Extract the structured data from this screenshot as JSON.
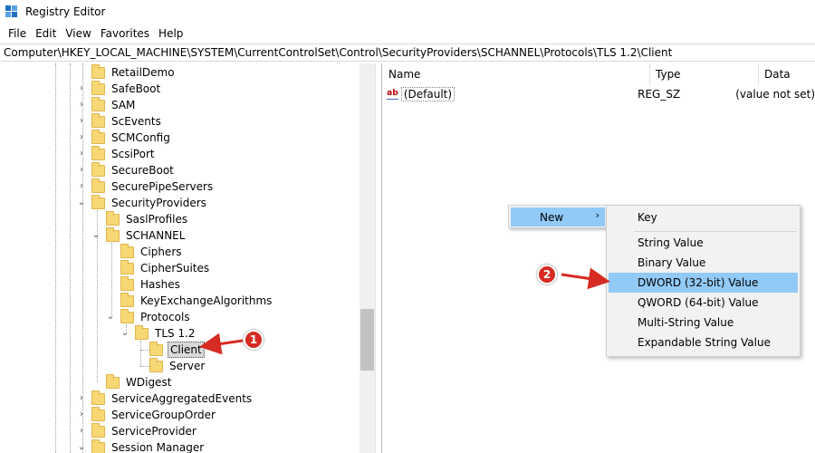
{
  "window": {
    "title": "Registry Editor"
  },
  "menu": [
    "File",
    "Edit",
    "View",
    "Favorites",
    "Help"
  ],
  "address": "Computer\\HKEY_LOCAL_MACHINE\\SYSTEM\\CurrentControlSet\\Control\\SecurityProviders\\SCHANNEL\\Protocols\\TLS 1.2\\Client",
  "tree": {
    "items": [
      {
        "label": "RetailDemo",
        "expanded": false
      },
      {
        "label": "SafeBoot",
        "expanded": false
      },
      {
        "label": "SAM",
        "expanded": false
      },
      {
        "label": "ScEvents",
        "expanded": false
      },
      {
        "label": "SCMConfig",
        "expanded": false
      },
      {
        "label": "ScsiPort",
        "expanded": false
      },
      {
        "label": "SecureBoot",
        "expanded": false
      },
      {
        "label": "SecurePipeServers",
        "expanded": false
      },
      {
        "label": "SecurityProviders",
        "expanded": true
      },
      {
        "label": "SaslProfiles",
        "expanded": false
      },
      {
        "label": "SCHANNEL",
        "expanded": true
      },
      {
        "label": "Ciphers",
        "expanded": false
      },
      {
        "label": "CipherSuites",
        "expanded": false
      },
      {
        "label": "Hashes",
        "expanded": false
      },
      {
        "label": "KeyExchangeAlgorithms",
        "expanded": false
      },
      {
        "label": "Protocols",
        "expanded": true
      },
      {
        "label": "TLS 1.2",
        "expanded": true
      },
      {
        "label": "Client",
        "selected": true
      },
      {
        "label": "Server"
      },
      {
        "label": "WDigest",
        "expanded": false
      },
      {
        "label": "ServiceAggregatedEvents",
        "expanded": false
      },
      {
        "label": "ServiceGroupOrder",
        "expanded": false
      },
      {
        "label": "ServiceProvider",
        "expanded": false
      },
      {
        "label": "Session Manager",
        "expanded": true
      }
    ]
  },
  "list": {
    "columns": {
      "name": "Name",
      "type": "Type",
      "data": "Data"
    },
    "rows": [
      {
        "name": "(Default)",
        "type": "REG_SZ",
        "data": "(value not set)",
        "icon": "string-value-icon"
      }
    ]
  },
  "context_menu": {
    "new_label": "New",
    "submenu": [
      "Key",
      "String Value",
      "Binary Value",
      "DWORD (32-bit) Value",
      "QWORD (64-bit) Value",
      "Multi-String Value",
      "Expandable String Value"
    ],
    "highlighted": "DWORD (32-bit) Value"
  },
  "callouts": [
    "1",
    "2"
  ],
  "colors": {
    "highlight": "#91c9f7",
    "folder": "#f8d775",
    "callout": "#d62b22"
  }
}
